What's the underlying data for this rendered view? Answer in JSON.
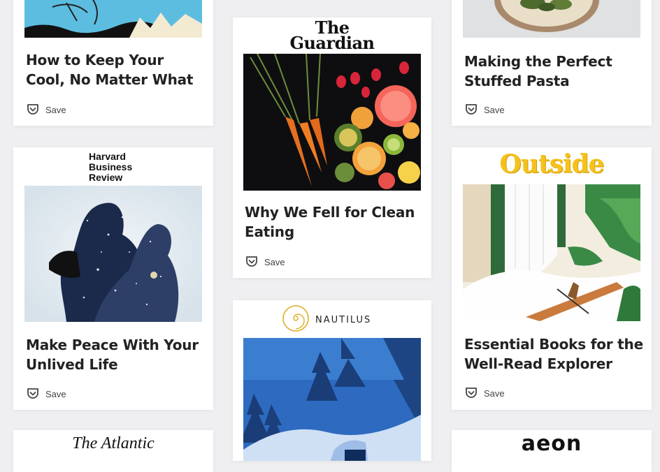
{
  "save_label": "Save",
  "cards": [
    {
      "title": "How to Keep Your Cool, No Matter What"
    },
    {
      "publisher": "Harvard Business Review",
      "publisher_lines": [
        "Harvard",
        "Business",
        "Review"
      ],
      "title": "Make Peace With Your Unlived Life"
    },
    {
      "publisher": "The Atlantic"
    },
    {
      "publisher": "The Guardian",
      "publisher_lines": [
        "The",
        "Guardian"
      ],
      "title": "Why We Fell for Clean Eating"
    },
    {
      "publisher": "NAUTILUS"
    },
    {
      "title": "Making the Perfect Stuffed Pasta"
    },
    {
      "publisher": "Outside",
      "title": "Essential Books for the Well-Read Explorer"
    },
    {
      "publisher": "aeon"
    }
  ],
  "colors": {
    "outside_yellow": "#f4c21b",
    "nautilus_gold": "#e2b53c",
    "page_bg": "#efeff1"
  },
  "icons": {
    "save": "pocket-save-icon"
  }
}
